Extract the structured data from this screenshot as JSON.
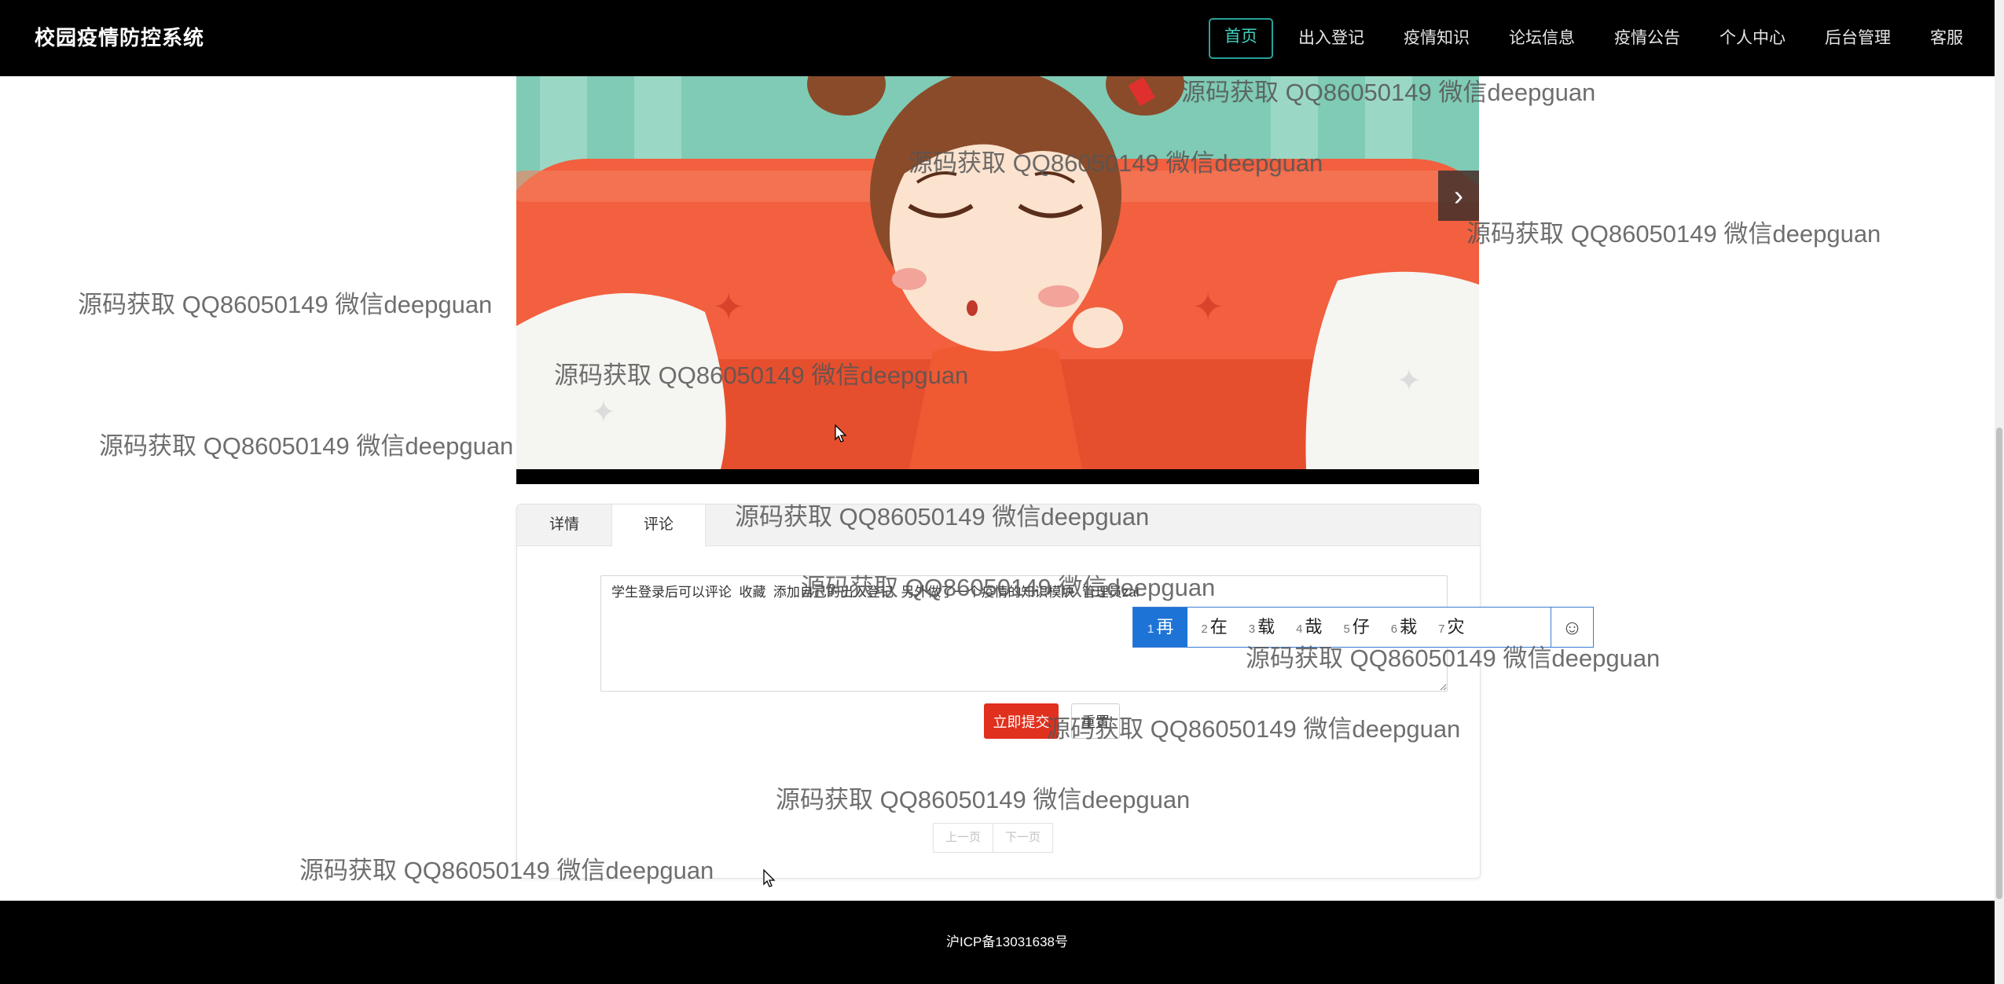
{
  "header": {
    "brand": "校园疫情防控系统",
    "nav": [
      "首页",
      "出入登记",
      "疫情知识",
      "论坛信息",
      "疫情公告",
      "个人中心",
      "后台管理",
      "客服"
    ],
    "active_nav": "首页"
  },
  "video": {
    "next_icon": "chevron-right-icon",
    "next_glyph": "›"
  },
  "tabs": {
    "detail": "详情",
    "comment": "评论",
    "active": "评论"
  },
  "comment_form": {
    "label": "评论",
    "value": "学生登录后可以评论  收藏  添加自己的出入登记  另外做了一个疫情的知识模块  管理员zai",
    "submit": "立即提交",
    "reset": "重置"
  },
  "pagination": {
    "prev": "上一页",
    "next": "下一页"
  },
  "ime": {
    "candidates": [
      {
        "n": "1",
        "c": "再"
      },
      {
        "n": "2",
        "c": "在"
      },
      {
        "n": "3",
        "c": "载"
      },
      {
        "n": "4",
        "c": "哉"
      },
      {
        "n": "5",
        "c": "仔"
      },
      {
        "n": "6",
        "c": "栽"
      },
      {
        "n": "7",
        "c": "灾"
      }
    ],
    "emoji": "☺"
  },
  "footer": {
    "icp": "沪ICP备13031638号"
  },
  "watermark": "源码获取 QQ86050149 微信deepguan",
  "colors": {
    "nav_bg": "#000000",
    "nav_active": "#2aa198",
    "submit_bg": "#e0301e",
    "ime_selected": "#1e74d6"
  }
}
